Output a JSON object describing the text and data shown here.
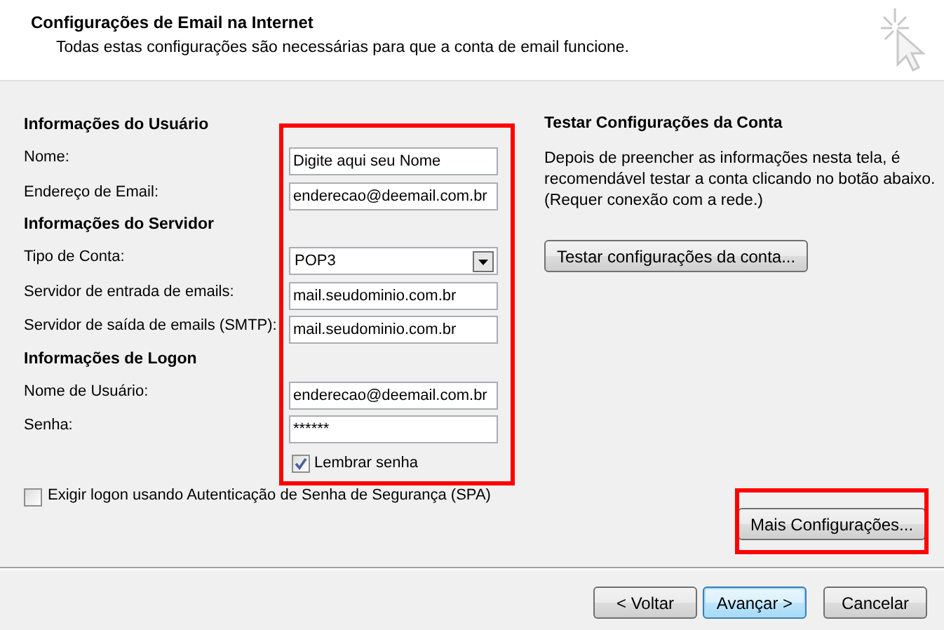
{
  "header": {
    "title": "Configurações de Email na Internet",
    "subtitle": "Todas estas configurações são necessárias para que a conta de email funcione."
  },
  "form": {
    "sections": [
      {
        "heading": "Informações do Usuário",
        "fields": [
          {
            "label": "Nome:",
            "value": "Digite aqui seu Nome",
            "kind": "text"
          },
          {
            "label": "Endereço de Email:",
            "value": "enderecao@deemail.com.br",
            "kind": "text"
          }
        ]
      },
      {
        "heading": "Informações do Servidor",
        "fields": [
          {
            "label": "Tipo de Conta:",
            "value": "POP3",
            "kind": "select"
          },
          {
            "label": "Servidor de entrada de emails:",
            "value": "mail.seudominio.com.br",
            "kind": "text"
          },
          {
            "label": "Servidor de saída de emails (SMTP):",
            "value": "mail.seudominio.com.br",
            "kind": "text"
          }
        ]
      },
      {
        "heading": "Informações de Logon",
        "fields": [
          {
            "label": "Nome de Usuário:",
            "value": "enderecao@deemail.com.br",
            "kind": "text"
          },
          {
            "label": "Senha:",
            "value": "******",
            "kind": "password"
          }
        ]
      }
    ],
    "remember_password": {
      "label": "Lembrar senha",
      "checked": true
    },
    "spa": {
      "label": "Exigir logon usando Autenticação de Senha de Segurança (SPA)",
      "checked": false
    }
  },
  "test": {
    "heading": "Testar Configurações da Conta",
    "description": "Depois de preencher as informações nesta tela, é recomendável testar a conta clicando no botão abaixo. (Requer conexão com a rede.)",
    "button": "Testar configurações da conta..."
  },
  "more_button": "Mais Configurações...",
  "nav_buttons": [
    {
      "label": "< Voltar",
      "default": false
    },
    {
      "label": "Avançar >",
      "default": true
    },
    {
      "label": "Cancelar",
      "default": false
    }
  ]
}
